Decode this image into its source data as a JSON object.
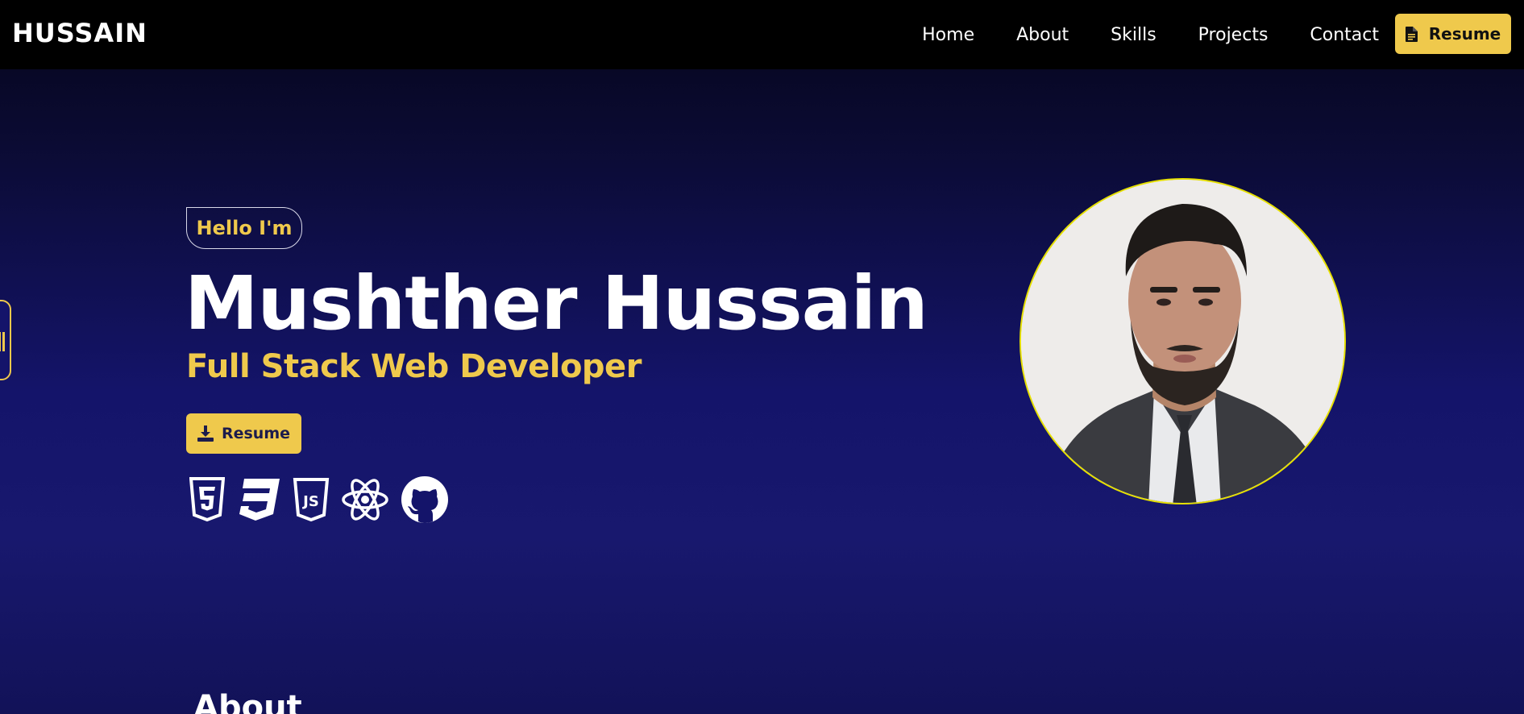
{
  "nav": {
    "brand": "HUSSAIN",
    "links": [
      {
        "label": "Home"
      },
      {
        "label": "About"
      },
      {
        "label": "Skills"
      },
      {
        "label": "Projects"
      },
      {
        "label": "Contact"
      }
    ],
    "resume_label": "Resume",
    "resume_icon": "file-icon"
  },
  "hero": {
    "greeting": "Hello I'm",
    "name": "Mushther Hussain",
    "role": "Full Stack Web Developer",
    "resume_label": "Resume",
    "resume_icon": "download-icon",
    "tech_icons": [
      "html5-icon",
      "css3-icon",
      "javascript-icon",
      "react-icon",
      "github-icon"
    ]
  },
  "about": {
    "heading": "About"
  },
  "colors": {
    "accent": "#efc94c",
    "navbar": "#000000",
    "background_top": "#05051a",
    "background_bottom": "#18186e",
    "portrait_border": "#e6e000"
  }
}
